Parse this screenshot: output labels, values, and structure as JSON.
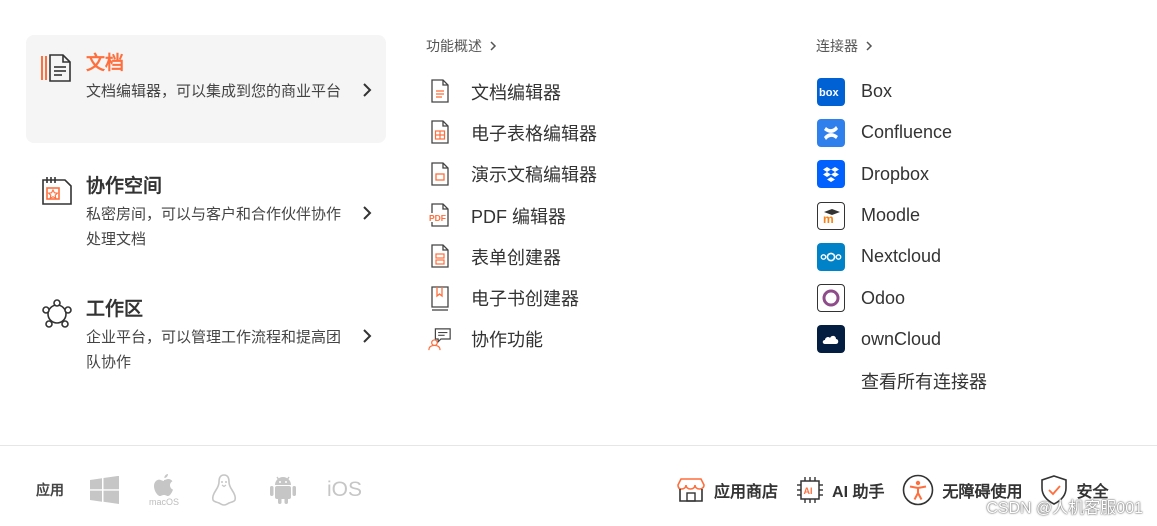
{
  "products": [
    {
      "title": "文档",
      "desc": "文档编辑器，可以集成到您的商业平台",
      "active": true,
      "icon": "docs-icon"
    },
    {
      "title": "协作空间",
      "desc": "私密房间，可以与客户和合作伙伴协作处理文档",
      "active": false,
      "icon": "rooms-icon"
    },
    {
      "title": "工作区",
      "desc": "企业平台，可以管理工作流程和提高团队协作",
      "active": false,
      "icon": "workspace-icon"
    }
  ],
  "features": {
    "header": "功能概述",
    "items": [
      {
        "label": "文档编辑器",
        "icon": "document-icon"
      },
      {
        "label": "电子表格编辑器",
        "icon": "spreadsheet-icon"
      },
      {
        "label": "演示文稿编辑器",
        "icon": "presentation-icon"
      },
      {
        "label": "PDF 编辑器",
        "icon": "pdf-icon"
      },
      {
        "label": "表单创建器",
        "icon": "form-icon"
      },
      {
        "label": "电子书创建器",
        "icon": "ebook-icon"
      },
      {
        "label": "协作功能",
        "icon": "collaboration-icon"
      }
    ]
  },
  "connectors": {
    "header": "连接器",
    "items": [
      {
        "label": "Box",
        "icon": "box-logo-icon",
        "color": "#0061d5"
      },
      {
        "label": "Confluence",
        "icon": "confluence-logo-icon",
        "color": "#2f80ed"
      },
      {
        "label": "Dropbox",
        "icon": "dropbox-logo-icon",
        "color": "#0061fe"
      },
      {
        "label": "Moodle",
        "icon": "moodle-logo-icon",
        "color": "#f98012"
      },
      {
        "label": "Nextcloud",
        "icon": "nextcloud-logo-icon",
        "color": "#0082c9"
      },
      {
        "label": "Odoo",
        "icon": "odoo-logo-icon",
        "color": "#8f4c8a"
      },
      {
        "label": "ownCloud",
        "icon": "owncloud-logo-icon",
        "color": "#041e42"
      }
    ],
    "all_label": "查看所有连接器"
  },
  "footer": {
    "apps_label": "应用",
    "platforms": [
      "windows-icon",
      "macos-icon",
      "linux-icon",
      "android-icon",
      "ios-icon"
    ],
    "macos_text": "macOS",
    "ios_text": "iOS",
    "links": [
      {
        "label": "应用商店",
        "icon": "store-icon"
      },
      {
        "label": "AI 助手",
        "icon": "ai-chip-icon"
      },
      {
        "label": "无障碍使用",
        "icon": "accessibility-icon"
      },
      {
        "label": "安全",
        "icon": "shield-icon"
      }
    ]
  },
  "watermark": "CSDN @人机客服001",
  "colors": {
    "accent": "#ff6f3d",
    "muted": "#c6c6c6"
  }
}
